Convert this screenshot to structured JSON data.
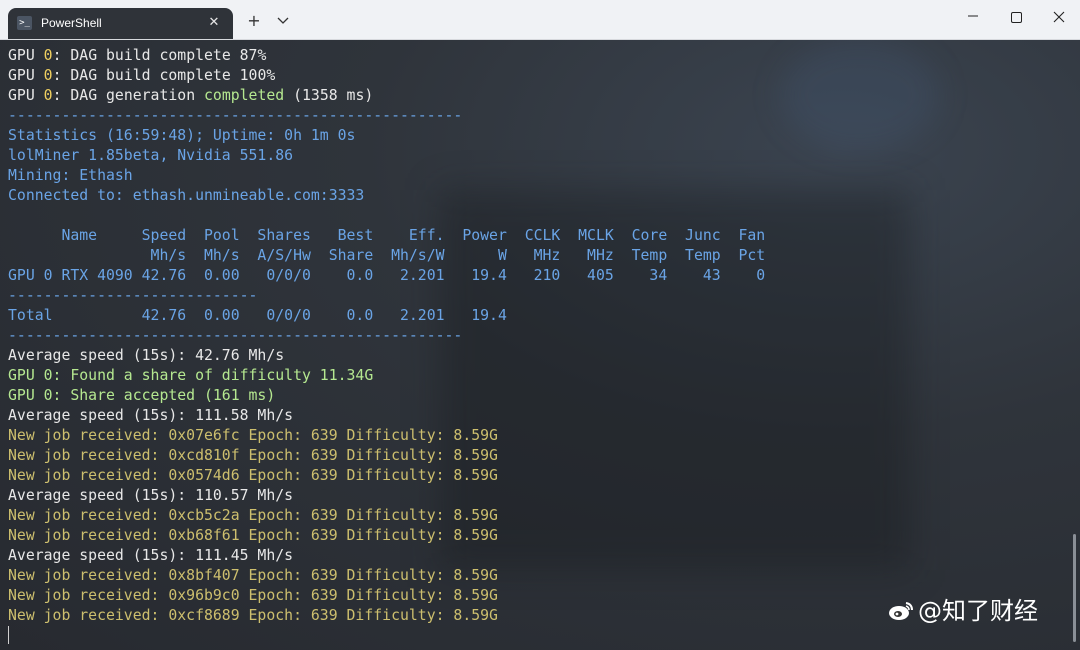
{
  "window": {
    "tab_title": "PowerShell",
    "tab_icon": "powershell-icon",
    "tab_close": "✕",
    "new_tab": "+",
    "dropdown": "⌄",
    "minimize": "—",
    "maximize": "☐",
    "close": "✕"
  },
  "terminal": {
    "lines": [
      {
        "segments": [
          {
            "t": "GPU ",
            "c": "white"
          },
          {
            "t": "0",
            "c": "yellow"
          },
          {
            "t": ": DAG build complete 87%",
            "c": "white"
          }
        ]
      },
      {
        "segments": [
          {
            "t": "GPU ",
            "c": "white"
          },
          {
            "t": "0",
            "c": "yellow"
          },
          {
            "t": ": DAG build complete 100%",
            "c": "white"
          }
        ]
      },
      {
        "segments": [
          {
            "t": "GPU ",
            "c": "white"
          },
          {
            "t": "0",
            "c": "yellow"
          },
          {
            "t": ": DAG generation ",
            "c": "white"
          },
          {
            "t": "completed",
            "c": "green"
          },
          {
            "t": " (1358 ms)",
            "c": "white"
          }
        ]
      },
      {
        "segments": [
          {
            "t": "---------------------------------------------------",
            "c": "blue"
          }
        ]
      },
      {
        "segments": [
          {
            "t": "Statistics (16:59:48); Uptime: 0h 1m 0s",
            "c": "blue"
          }
        ]
      },
      {
        "segments": [
          {
            "t": "lolMiner 1.85beta, Nvidia 551.86",
            "c": "blue"
          }
        ]
      },
      {
        "segments": [
          {
            "t": "Mining: Ethash",
            "c": "blue"
          }
        ]
      },
      {
        "segments": [
          {
            "t": "Connected to: ethash.unmineable.com:3333",
            "c": "blue"
          }
        ]
      },
      {
        "segments": [
          {
            "t": "",
            "c": "blue"
          }
        ]
      },
      {
        "segments": [
          {
            "t": "      Name     Speed  Pool  Shares   Best    Eff.  Power  CCLK  MCLK  Core  Junc  Fan",
            "c": "blue"
          }
        ]
      },
      {
        "segments": [
          {
            "t": "                Mh/s  Mh/s  A/S/Hw  Share  Mh/s/W      W   MHz   MHz  Temp  Temp  Pct",
            "c": "blue"
          }
        ]
      },
      {
        "segments": [
          {
            "t": "GPU 0 RTX 4090 42.76  0.00   0/0/0    0.0   2.201   19.4   210   405    34    43    0",
            "c": "blue"
          }
        ]
      },
      {
        "segments": [
          {
            "t": "----------------------------",
            "c": "blue"
          }
        ]
      },
      {
        "segments": [
          {
            "t": "Total          42.76  0.00   0/0/0    0.0   2.201   19.4",
            "c": "blue"
          }
        ]
      },
      {
        "segments": [
          {
            "t": "---------------------------------------------------",
            "c": "blue"
          }
        ]
      },
      {
        "segments": [
          {
            "t": "Average speed (15s): 42.76 Mh/s",
            "c": "white"
          }
        ]
      },
      {
        "segments": [
          {
            "t": "GPU 0: Found a share of difficulty 11.34G",
            "c": "gline"
          }
        ]
      },
      {
        "segments": [
          {
            "t": "GPU 0: Share accepted (161 ms)",
            "c": "gline"
          }
        ]
      },
      {
        "segments": [
          {
            "t": "Average speed (15s): 111.58 Mh/s",
            "c": "white"
          }
        ]
      },
      {
        "segments": [
          {
            "t": "New job received: 0x07e6fc Epoch: 639 Difficulty: 8.59G",
            "c": "tan"
          }
        ]
      },
      {
        "segments": [
          {
            "t": "New job received: 0xcd810f Epoch: 639 Difficulty: 8.59G",
            "c": "tan"
          }
        ]
      },
      {
        "segments": [
          {
            "t": "New job received: 0x0574d6 Epoch: 639 Difficulty: 8.59G",
            "c": "tan"
          }
        ]
      },
      {
        "segments": [
          {
            "t": "Average speed (15s): 110.57 Mh/s",
            "c": "white"
          }
        ]
      },
      {
        "segments": [
          {
            "t": "New job received: 0xcb5c2a Epoch: 639 Difficulty: 8.59G",
            "c": "tan"
          }
        ]
      },
      {
        "segments": [
          {
            "t": "New job received: 0xb68f61 Epoch: 639 Difficulty: 8.59G",
            "c": "tan"
          }
        ]
      },
      {
        "segments": [
          {
            "t": "Average speed (15s): 111.45 Mh/s",
            "c": "white"
          }
        ]
      },
      {
        "segments": [
          {
            "t": "New job received: 0x8bf407 Epoch: 639 Difficulty: 8.59G",
            "c": "tan"
          }
        ]
      },
      {
        "segments": [
          {
            "t": "New job received: 0x96b9c0 Epoch: 639 Difficulty: 8.59G",
            "c": "tan"
          }
        ]
      },
      {
        "segments": [
          {
            "t": "New job received: 0xcf8689 Epoch: 639 Difficulty: 8.59G",
            "c": "tan"
          }
        ]
      }
    ]
  },
  "watermark": {
    "text": "@知了财经",
    "icon": "weibo-logo-icon"
  },
  "colors": {
    "white": "#e8e8e8",
    "yellow": "#f0d060",
    "green": "#b5e890",
    "blue": "#6aa4e6",
    "tan": "#cdbf6e"
  }
}
